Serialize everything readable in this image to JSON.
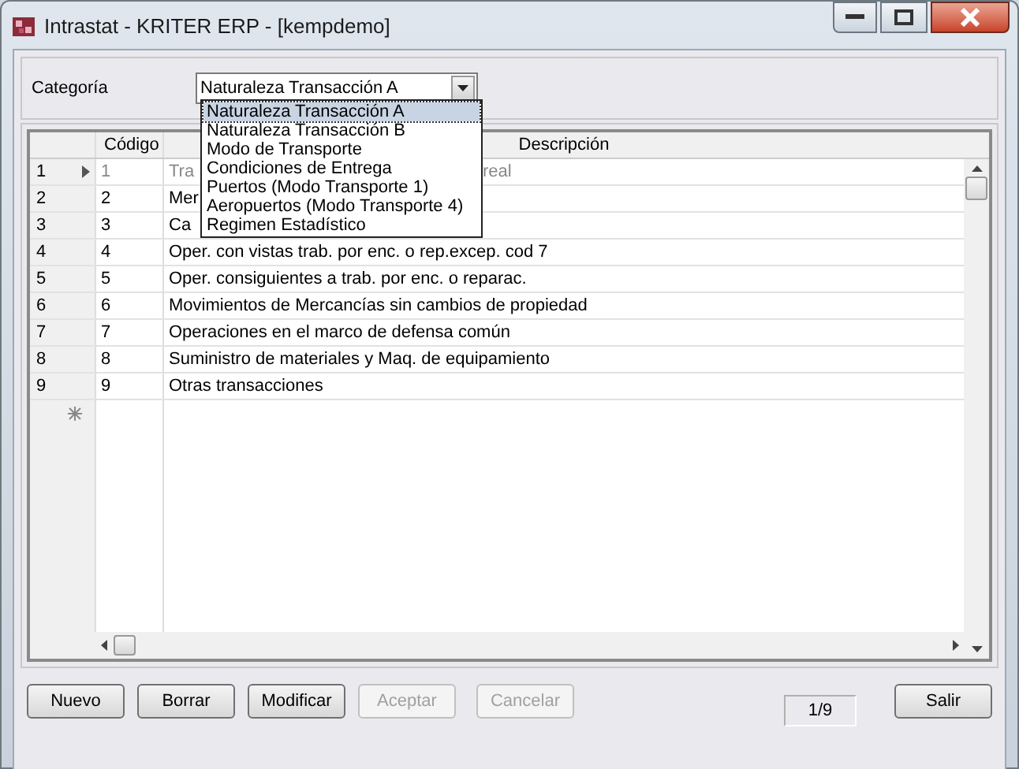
{
  "window": {
    "title": "Intrastat - KRITER ERP - [kempdemo]"
  },
  "category": {
    "label": "Categoría",
    "value": "Naturaleza Transacción A",
    "expanded": true,
    "options": [
      {
        "label": "Naturaleza Transacción A",
        "selected": true
      },
      {
        "label": "Naturaleza Transacción B",
        "selected": false
      },
      {
        "label": "Modo de Transporte",
        "selected": false
      },
      {
        "label": "Condiciones de Entrega",
        "selected": false
      },
      {
        "label": "Puertos (Modo Transporte 1)",
        "selected": false
      },
      {
        "label": "Aeropuertos (Modo Transporte 4)",
        "selected": false
      },
      {
        "label": "Regimen Estadístico",
        "selected": false
      }
    ]
  },
  "table": {
    "columns": [
      "Código",
      "Descripción"
    ],
    "rows": [
      {
        "number": "1",
        "code": "1",
        "description": "Tra",
        "description_tail": "real",
        "current": true
      },
      {
        "number": "2",
        "code": "2",
        "description": "Mer",
        "current": false
      },
      {
        "number": "3",
        "code": "3",
        "description": "Ca",
        "current": false
      },
      {
        "number": "4",
        "code": "4",
        "description": "Oper. con vistas trab. por enc. o rep.excep. cod 7",
        "current": false
      },
      {
        "number": "5",
        "code": "5",
        "description": "Oper. consiguientes a trab. por enc. o  reparac.",
        "current": false
      },
      {
        "number": "6",
        "code": "6",
        "description": "Movimientos de Mercancías sin cambios de propiedad",
        "current": false
      },
      {
        "number": "7",
        "code": "7",
        "description": "Operaciones en el marco de defensa común",
        "current": false
      },
      {
        "number": "8",
        "code": "8",
        "description": "Suministro de materiales y Maq. de equipamiento",
        "current": false
      },
      {
        "number": "9",
        "code": "9",
        "description": "Otras transacciones",
        "current": false
      }
    ]
  },
  "buttons": [
    {
      "label": "Nuevo",
      "disabled": false
    },
    {
      "label": "Borrar",
      "disabled": false
    },
    {
      "label": "Modificar",
      "disabled": false
    },
    {
      "label": "Aceptar",
      "disabled": true
    },
    {
      "label": "Cancelar",
      "disabled": true
    }
  ],
  "record_counter": "1/9",
  "exit_button": {
    "label": "Salir"
  }
}
